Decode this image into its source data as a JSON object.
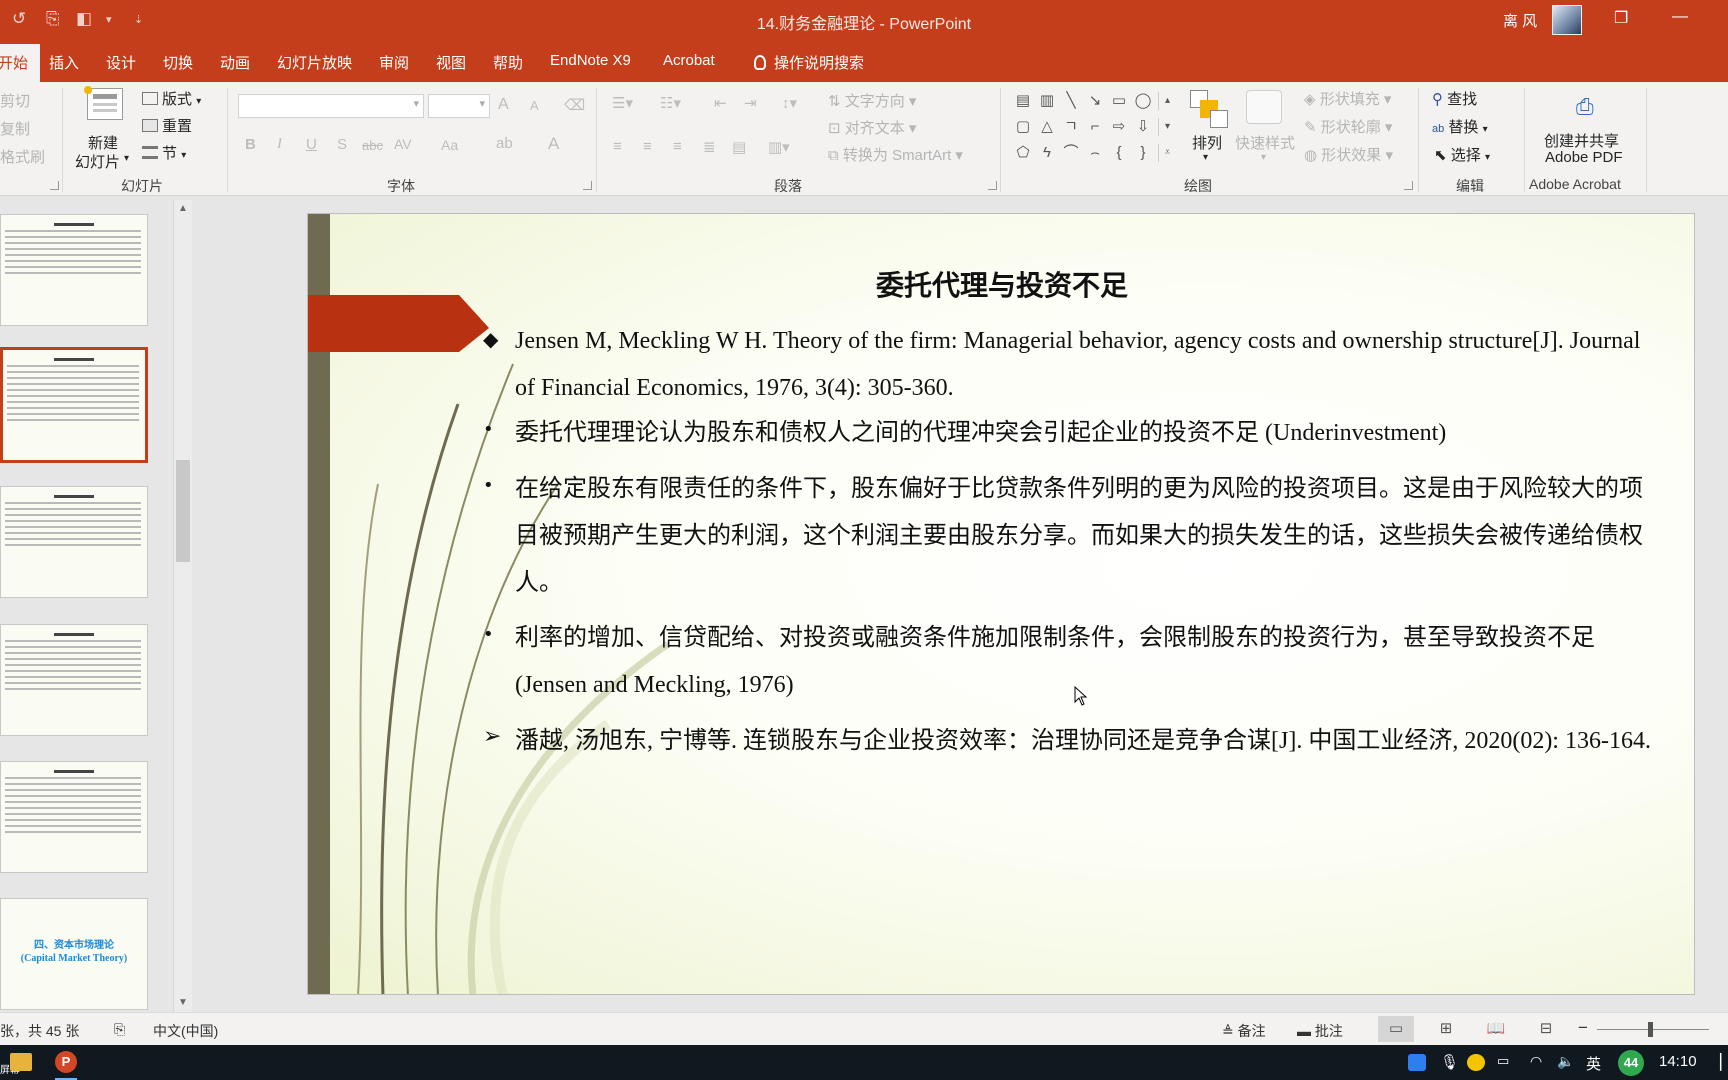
{
  "titlebar": {
    "document_title": "14.财务金融理论 - PowerPoint",
    "user_name": "离 风",
    "quick_access": [
      "undo-icon",
      "touch-mode-icon",
      "layout-icon",
      "customize-icon"
    ],
    "restore_icon": "❐",
    "minimize_icon": "—"
  },
  "tabs": {
    "home": "开始",
    "insert": "插入",
    "design": "设计",
    "transitions": "切换",
    "animations": "动画",
    "slideshow": "幻灯片放映",
    "review": "审阅",
    "view": "视图",
    "help": "帮助",
    "endnote": "EndNote X9",
    "acrobat": "Acrobat",
    "tell_me": "操作说明搜索"
  },
  "ribbon": {
    "clipboard": {
      "cut": "剪切",
      "copy": "复制",
      "format_painter": "格式刷"
    },
    "slides": {
      "new_slide_line1": "新建",
      "new_slide_line2": "幻灯片",
      "layout": "版式",
      "reset": "重置",
      "section": "节",
      "group_label": "幻灯片"
    },
    "font": {
      "group_label": "字体",
      "font_name": "",
      "font_size": "",
      "bold": "B",
      "italic": "I",
      "underline": "U",
      "shadow": "S",
      "strike": "abc",
      "spacing": "AV",
      "case": "Aa",
      "color": "A",
      "grow": "A",
      "shrink": "A"
    },
    "paragraph": {
      "group_label": "段落",
      "text_direction": "文字方向",
      "align_text": "对齐文本",
      "smartart": "转换为 SmartArt"
    },
    "drawing": {
      "group_label": "绘图",
      "arrange": "排列",
      "quick_styles": "快速样式",
      "shape_fill": "形状填充",
      "shape_outline": "形状轮廓",
      "shape_effects": "形状效果"
    },
    "editing": {
      "group_label": "编辑",
      "find": "查找",
      "replace": "替换",
      "select": "选择"
    },
    "acrobat": {
      "create_share_line1": "创建并共享",
      "create_share_line2": "Adobe PDF",
      "group_label": "Adobe Acrobat"
    }
  },
  "thumbnails": [
    {
      "kind": "text",
      "selected": false
    },
    {
      "kind": "text",
      "selected": true
    },
    {
      "kind": "text",
      "selected": false
    },
    {
      "kind": "text",
      "selected": false
    },
    {
      "kind": "text",
      "selected": false
    },
    {
      "kind": "section",
      "selected": false,
      "title_line1": "四、资本市场理论",
      "title_line2": "(Capital Market Theory)"
    }
  ],
  "slide": {
    "title": "委托代理与投资不足",
    "paragraphs": [
      {
        "bullet": "◆",
        "text": "Jensen M, Meckling W H. Theory of the firm: Managerial behavior, agency costs and ownership structure[J]. Journal of Financial Economics, 1976, 3(4): 305-360."
      },
      {
        "bullet": "•",
        "text": "委托代理理论认为股东和债权人之间的代理冲突会引起企业的投资不足 (Underinvestment)"
      },
      {
        "bullet": "•",
        "text": "在给定股东有限责任的条件下，股东偏好于比贷款条件列明的更为风险的投资项目。这是由于风险较大的项目被预期产生更大的利润，这个利润主要由股东分享。而如果大的损失发生的话，这些损失会被传递给债权人。"
      },
      {
        "bullet": "•",
        "text": "利率的增加、信贷配给、对投资或融资条件施加限制条件，会限制股东的投资行为，甚至导致投资不足 (Jensen and Meckling, 1976)"
      },
      {
        "bullet": "➢",
        "text": "潘越, 汤旭东, 宁博等. 连锁股东与企业投资效率：治理协同还是竞争合谋[J]. 中国工业经济, 2020(02): 136-164."
      }
    ]
  },
  "statusbar": {
    "slide_counter": "张，共 45 张",
    "language": "中文(中国)",
    "notes": "备注",
    "comments": "批注",
    "zoom_minus": "−",
    "zoom_plus": "+"
  },
  "taskbar": {
    "start_label": "屏幕",
    "ime": "英",
    "badge": "44",
    "clock": "14:10"
  },
  "colors": {
    "accent": "#c43e1c",
    "slide_arrow": "#b83212",
    "slide_strip": "#6f6b50",
    "section_title": "#1e8ad6"
  }
}
